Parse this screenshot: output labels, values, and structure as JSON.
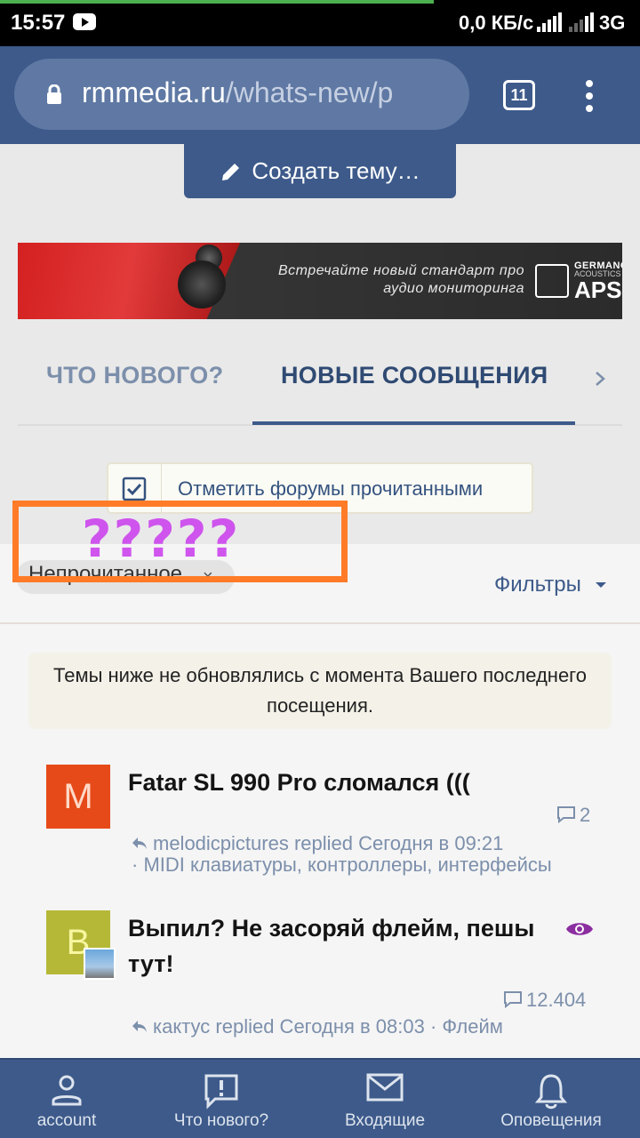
{
  "status_bar": {
    "time": "15:57",
    "net_speed": "0,0 КБ/с",
    "network": "3G"
  },
  "browser": {
    "url_host": "rmmedia.ru",
    "url_path": "/whats-new/p",
    "tab_count": "11"
  },
  "create_thread_label": "Создать тему…",
  "banner": {
    "text": "Встречайте новый стандарт про аудио мониторинга",
    "brand_line1": "GERMANO",
    "brand_line2": "ACOUSTICS",
    "brand_line3": "APS"
  },
  "tabs": [
    {
      "label": "ЧТО НОВОГО?",
      "active": false
    },
    {
      "label": "НОВЫЕ СООБЩЕНИЯ",
      "active": true
    }
  ],
  "mark_read_label": "Отметить форумы прочитанными",
  "filter": {
    "chip_label": "Непрочитанное",
    "chip_close": "×",
    "filters_label": "Фильтры"
  },
  "overlay": {
    "question": "?????"
  },
  "notice": "Темы ниже не обновлялись с момента Вашего последнего посещения.",
  "threads": [
    {
      "avatar_letter": "M",
      "title": "Fatar SL 990 Pro сломался (((",
      "replies": "2",
      "meta_line1": "melodicpictures replied Сегодня в 09:21",
      "meta_line2": "· MIDI клавиатуры, контроллеры, интерфейсы"
    },
    {
      "avatar_letter": "B",
      "title_line1": "Выпил? Не засоряй флейм, пешы",
      "title_line2": "тут!",
      "replies": "12.404",
      "meta_line1": "кактус replied Сегодня в 08:03 · Флейм"
    }
  ],
  "bottom_nav": [
    {
      "label": "account"
    },
    {
      "label": "Что нового?"
    },
    {
      "label": "Входящие"
    },
    {
      "label": "Оповещения"
    }
  ],
  "colors": {
    "primary": "#3d5a8a",
    "tab_inactive": "#7c8fab",
    "overlay_border": "#ff7b27",
    "overlay_text": "#cc44ee",
    "eye": "#8b2ea0"
  }
}
